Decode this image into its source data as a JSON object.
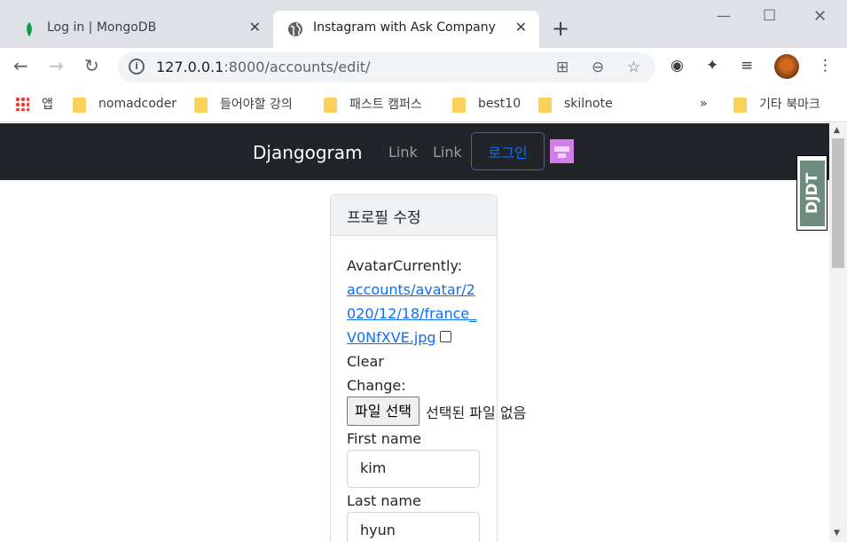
{
  "browser": {
    "tabs": [
      {
        "title": "Log in | MongoDB",
        "icon": "mongodb-leaf-icon"
      },
      {
        "title": "Instagram with Ask Company",
        "icon": "globe-icon"
      }
    ],
    "url_host": "127.0.0.1",
    "url_rest": ":8000/accounts/edit/",
    "bookmarks": {
      "apps": "앱",
      "items": [
        "nomadcoder",
        "들어야할 강의",
        "패스트 캠퍼스",
        "best10",
        "skilnote"
      ],
      "more": "»",
      "other": "기타 북마크"
    }
  },
  "navbar": {
    "brand": "Djangogram",
    "links": [
      "Link",
      "Link"
    ],
    "login": "로그인"
  },
  "card": {
    "header": "프로필 수정",
    "avatar_label": "Avatar",
    "currently_label": "Currently:",
    "avatar_link": "accounts/avatar/2020/12/18/france_V0NfXVE.jpg",
    "avatar_link_lines": [
      "accounts/avatar/2",
      "020/12/18/france_",
      "V0NfXVE.jpg"
    ],
    "clear_label": "Clear",
    "change_label": "Change:",
    "file_button": "파일 선택",
    "file_status": "선택된 파일 없음",
    "first_name_label": "First name",
    "first_name_value": "kim",
    "last_name_label": "Last name",
    "last_name_value": "hyun"
  },
  "djdt": {
    "label": "DJDT"
  },
  "colors": {
    "navbar": "#212529",
    "primary": "#0d6efd",
    "djdt": "#6d8c7e"
  }
}
